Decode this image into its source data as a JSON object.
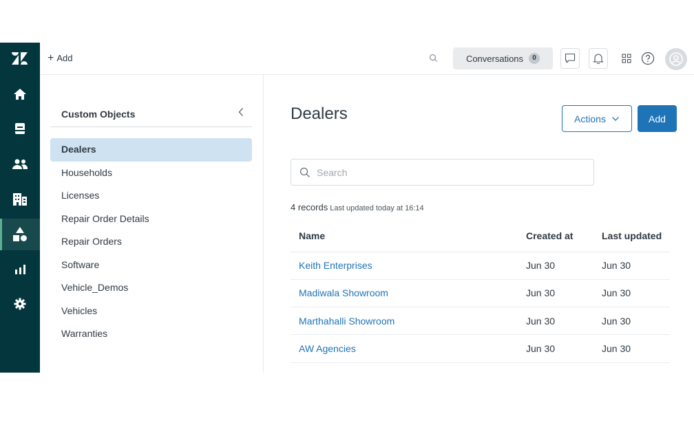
{
  "header": {
    "add_label": "Add",
    "conversations_label": "Conversations",
    "conversations_count": "0"
  },
  "rail": {
    "items": [
      {
        "icon": "home-icon"
      },
      {
        "icon": "views-icon"
      },
      {
        "icon": "customers-icon"
      },
      {
        "icon": "organizations-icon"
      },
      {
        "icon": "objects-icon",
        "active": true
      },
      {
        "icon": "reporting-icon"
      },
      {
        "icon": "admin-gear-icon"
      }
    ]
  },
  "subnav": {
    "title": "Custom Objects",
    "items": [
      {
        "label": "Dealers",
        "active": true
      },
      {
        "label": "Households"
      },
      {
        "label": "Licenses"
      },
      {
        "label": "Repair Order Details"
      },
      {
        "label": "Repair Orders"
      },
      {
        "label": "Software"
      },
      {
        "label": "Vehicle_Demos"
      },
      {
        "label": "Vehicles"
      },
      {
        "label": "Warranties"
      }
    ]
  },
  "main": {
    "title": "Dealers",
    "actions_label": "Actions",
    "add_label": "Add",
    "search_placeholder": "Search",
    "records_count": "4 records",
    "records_updated": "Last updated today at 16:14",
    "table": {
      "columns": [
        "Name",
        "Created at",
        "Last updated"
      ],
      "rows": [
        [
          "Keith Enterprises",
          "Jun 30",
          "Jun 30"
        ],
        [
          "Madiwala Showroom",
          "Jun 30",
          "Jun 30"
        ],
        [
          "Marthahalli Showroom",
          "Jun 30",
          "Jun 30"
        ],
        [
          "AW Agencies",
          "Jun 30",
          "Jun 30"
        ]
      ]
    }
  },
  "colors": {
    "rail_bg": "#03363d",
    "accent": "#1f73b7",
    "selected_bg": "#cee2f2"
  }
}
